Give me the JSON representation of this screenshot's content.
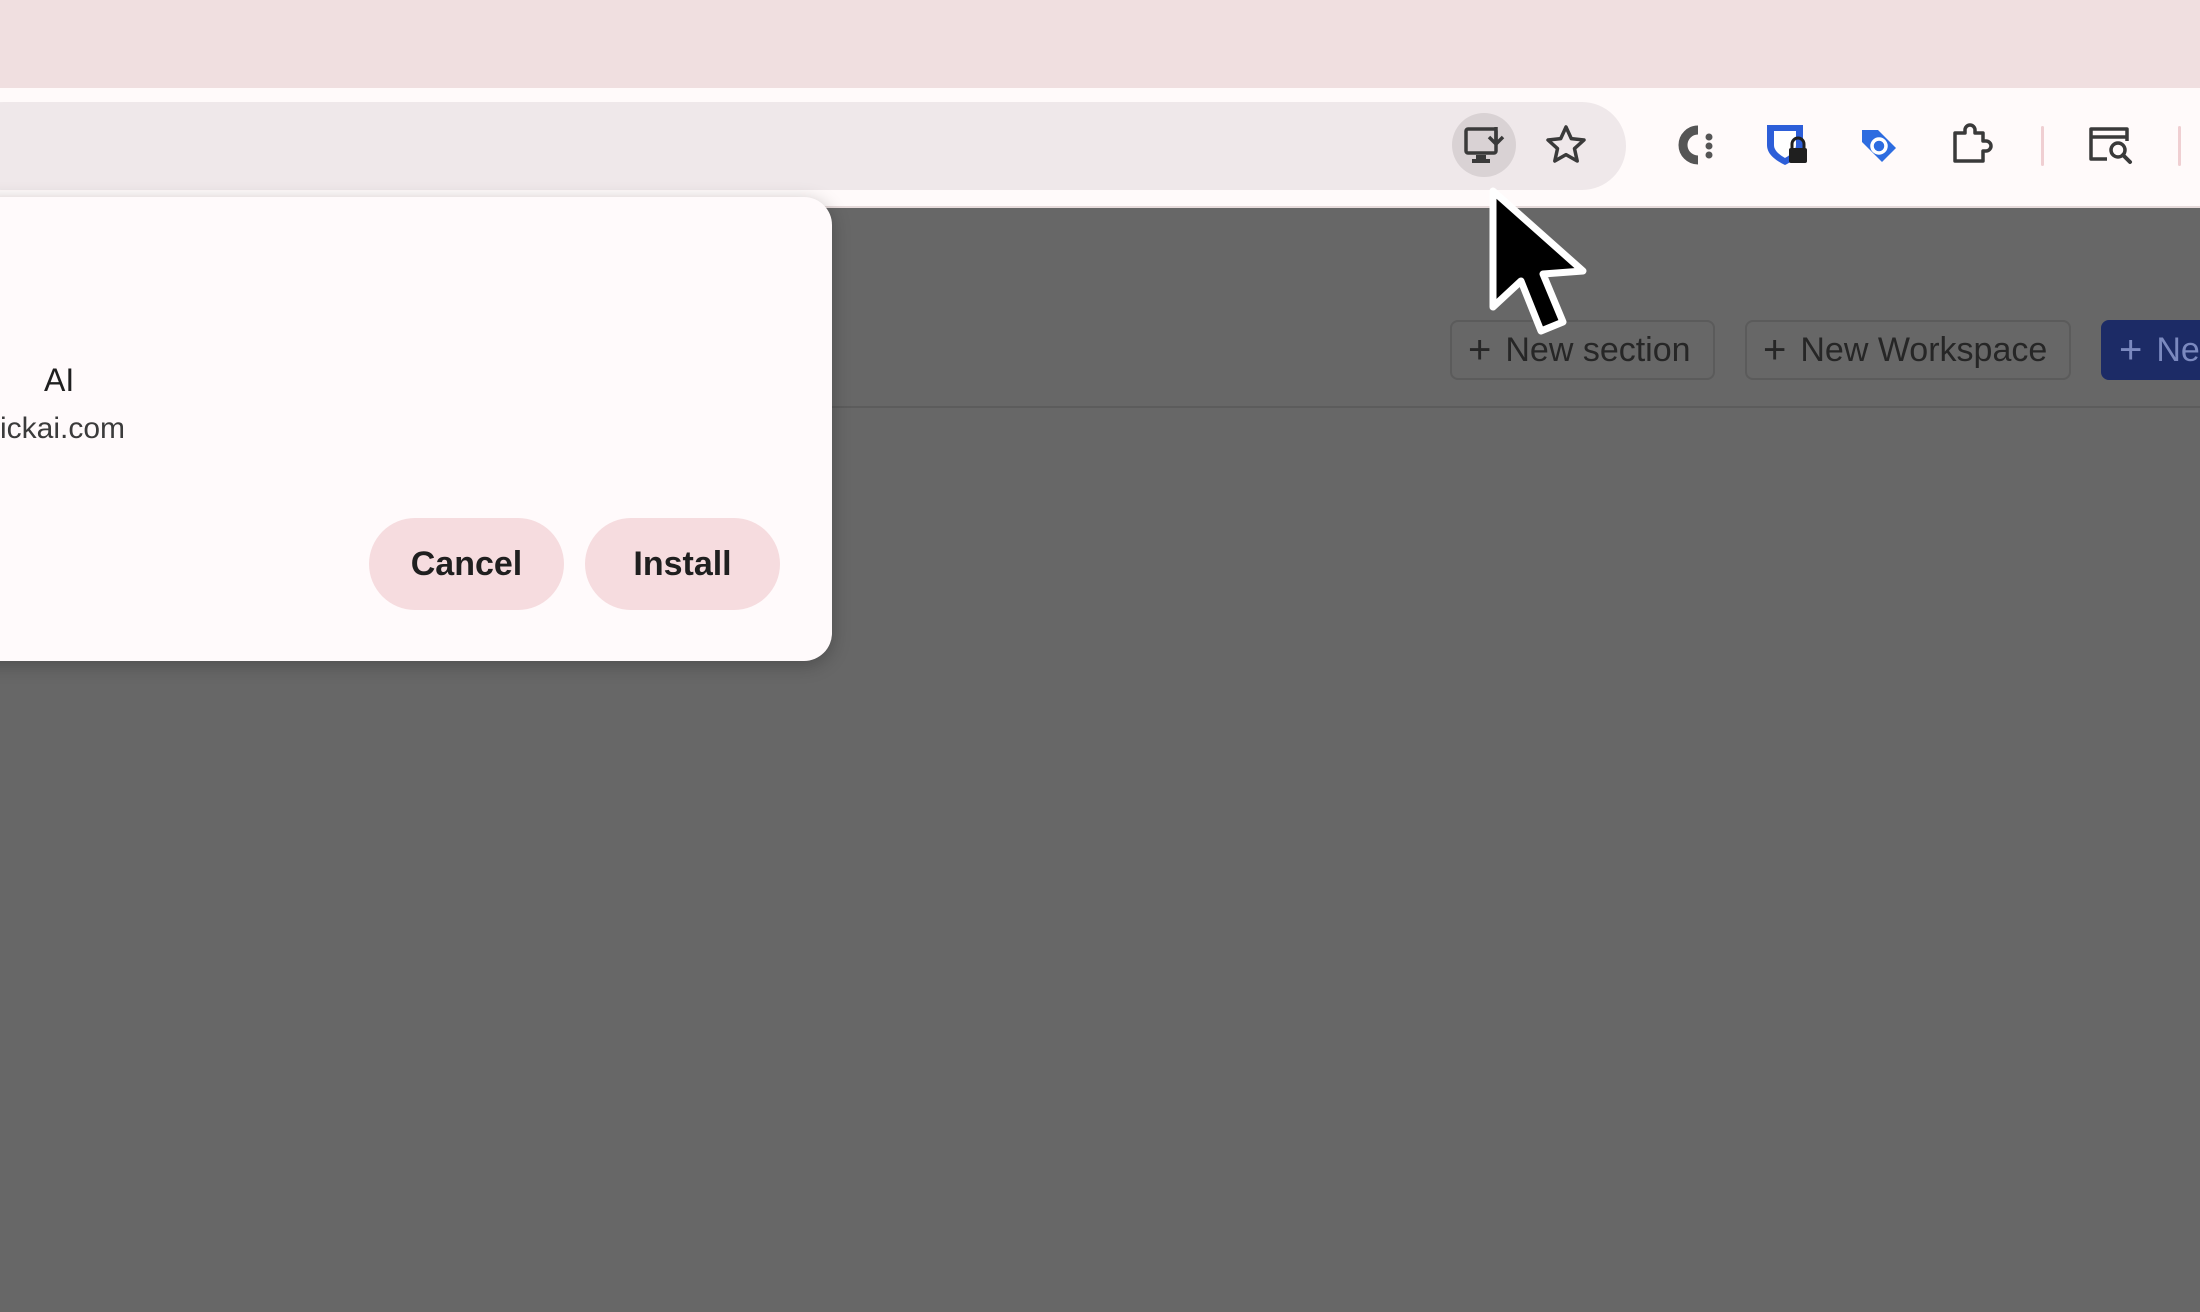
{
  "dialog": {
    "app_name": "AI",
    "app_origin": "ickai.com",
    "cancel_label": "Cancel",
    "install_label": "Install"
  },
  "page": {
    "new_section_label": "New section",
    "new_workspace_label": "New Workspace",
    "new_primary_label": "Ne"
  },
  "toolbar": {
    "icons": [
      "install-app-icon",
      "bookmark-star-icon",
      "extension-c-icon",
      "extension-lock-icon",
      "extension-tag-icon",
      "extensions-puzzle-icon",
      "tab-search-icon"
    ]
  },
  "colors": {
    "tabstrip": "#f0dfe0",
    "toolbar": "#fffafa",
    "overlay": "#676767",
    "dialog_button": "#f6dcdf",
    "primary_button": "#1c2b66",
    "extension_blue": "#2d6ce0"
  }
}
